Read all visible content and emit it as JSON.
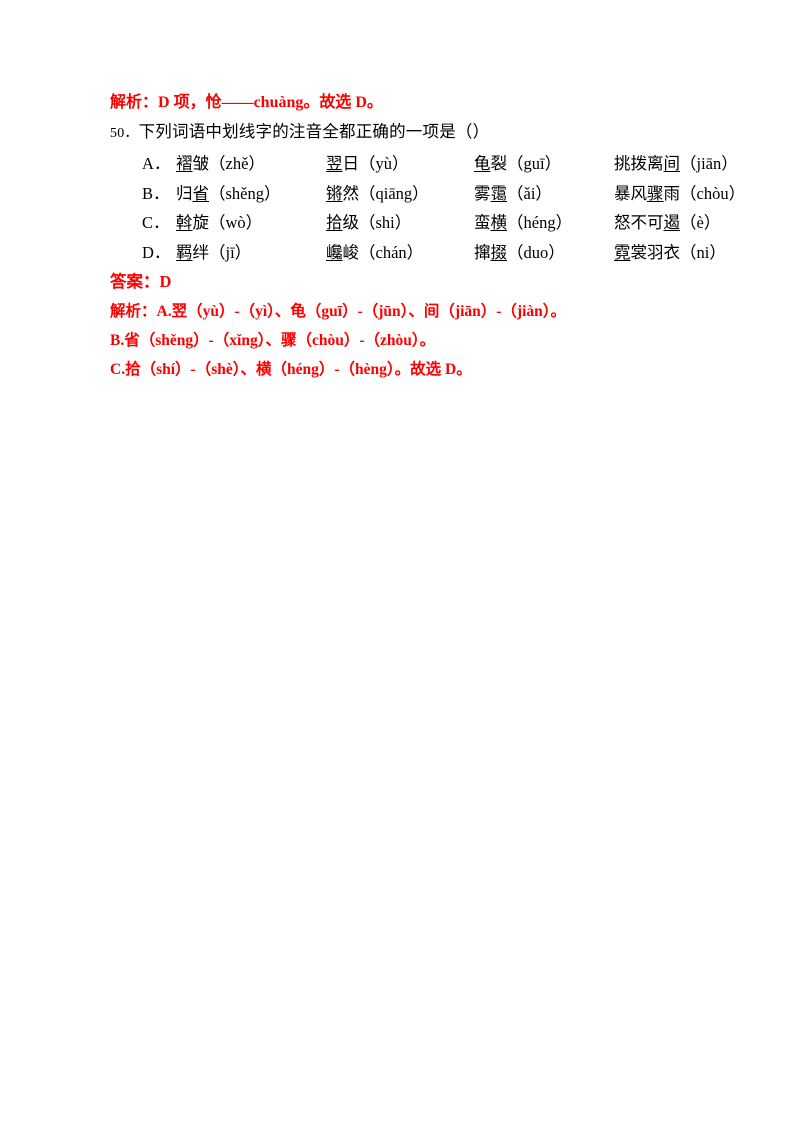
{
  "document": {
    "top_analysis": {
      "prefix": "解析：",
      "text": "D 项，怆——chuàng。故选 D。"
    },
    "question": {
      "number": "50",
      "number_suffix": "．",
      "stem": "下列词语中划线字的注音全都正确的一项是（",
      "stem_close": "）"
    },
    "options": [
      {
        "label": "A．",
        "items": [
          {
            "underlined": "褶",
            "rest": "皱",
            "pinyin": "（zhě）"
          },
          {
            "underlined": "翌",
            "rest": "日",
            "pinyin": "（yù）"
          },
          {
            "underlined": "龟",
            "rest": "裂",
            "pinyin": "（guī）"
          },
          {
            "pre": "挑拨离",
            "underlined": "间",
            "rest": "",
            "pinyin": "（jiān）"
          }
        ]
      },
      {
        "label": "B．",
        "items": [
          {
            "pre": "归",
            "underlined": "省",
            "rest": "",
            "pinyin": "（shěng）"
          },
          {
            "underlined": "锵",
            "rest": "然",
            "pinyin": "（qiāng）"
          },
          {
            "pre": "雾",
            "underlined": "霭",
            "rest": "",
            "pinyin": "（ǎi）"
          },
          {
            "pre": "暴风",
            "underlined": "骤",
            "rest": "雨",
            "pinyin": "（chòu）"
          }
        ]
      },
      {
        "label": "C．",
        "items": [
          {
            "underlined": "斡",
            "rest": "旋",
            "pinyin": "（wò）"
          },
          {
            "underlined": "拾",
            "rest": "级",
            "pinyin": "（shi）"
          },
          {
            "pre": "蛮",
            "underlined": "横",
            "rest": "",
            "pinyin": "（héng）"
          },
          {
            "pre": "怒不可",
            "underlined": "遏",
            "rest": "",
            "pinyin": "（è）"
          }
        ]
      },
      {
        "label": "D．",
        "items": [
          {
            "underlined": "羁",
            "rest": "绊",
            "pinyin": "（jī）"
          },
          {
            "underlined": "巉",
            "rest": "峻",
            "pinyin": "（chán）"
          },
          {
            "pre": "撺",
            "underlined": "掇",
            "rest": "",
            "pinyin": "（duo）"
          },
          {
            "underlined": "霓",
            "rest": "裳羽衣",
            "pinyin": "（ni）"
          }
        ]
      }
    ],
    "answer": {
      "prefix": "答案：",
      "value": "D"
    },
    "explanation": {
      "prefix": "解析：",
      "lines": [
        "A.翌（yù）-（yì）、龟（guī）-（jūn）、间（jiān）-（jiàn）。",
        "B.省（shěng）-（xǐng）、骤（chòu）-（zhòu）。",
        "C.拾（shí）-（shè）、横（héng）-（hèng）。故选 D。"
      ]
    },
    "colors": {
      "red": "#ff0000",
      "black": "#000000",
      "page_background": "#ffffff"
    }
  }
}
